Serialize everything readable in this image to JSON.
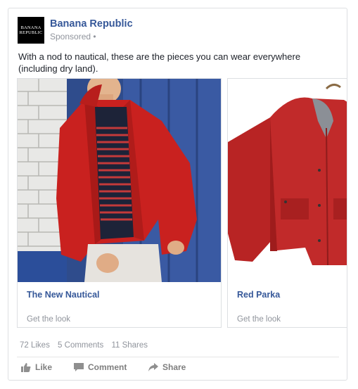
{
  "advertiser": {
    "name": "Banana Republic",
    "logo_line1": "BANANA",
    "logo_line2": "REPUBLIC",
    "sponsored_label": "Sponsored",
    "sponsored_separator": "•"
  },
  "post": {
    "caption": "With a nod to nautical, these are the pieces you can wear everywhere (including dry land)."
  },
  "carousel": {
    "cards": [
      {
        "title": "The New Nautical",
        "subtitle": "Get the look",
        "image_icon": "model-in-red-jacket-photo"
      },
      {
        "title": "Red Parka",
        "subtitle": "Get the look",
        "image_icon": "red-parka-on-hanger-photo"
      }
    ]
  },
  "stats": {
    "likes": "72 Likes",
    "comments": "5 Comments",
    "shares": "11 Shares"
  },
  "actions": {
    "like_label": "Like",
    "comment_label": "Comment",
    "share_label": "Share",
    "like_icon": "thumbs-up-icon",
    "comment_icon": "comment-icon",
    "share_icon": "share-arrow-icon"
  },
  "colors": {
    "link_blue": "#365899",
    "muted_gray": "#90949c",
    "jacket_red": "#c9201f",
    "wall_blue": "#2d4a8f"
  }
}
